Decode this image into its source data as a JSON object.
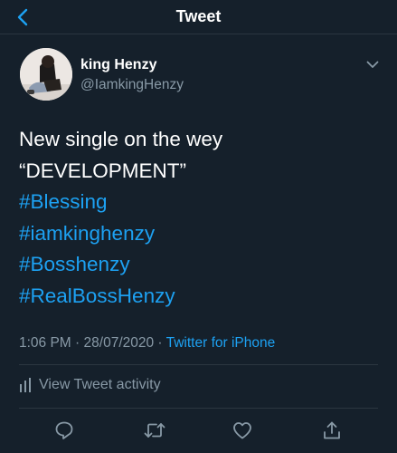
{
  "header": {
    "title": "Tweet",
    "back_icon": "chevron-left-icon"
  },
  "colors": {
    "background": "#15202b",
    "accent": "#1da1f2",
    "secondary_text": "#8899a6",
    "divider": "#2b3640"
  },
  "author": {
    "name": "king Henzy",
    "handle": "@IamkingHenzy",
    "more_icon": "chevron-down-icon"
  },
  "tweet": {
    "lines": [
      {
        "text": "New single on the wey",
        "hashtag": false
      },
      {
        "text": "“DEVELOPMENT”",
        "hashtag": false
      },
      {
        "text": "#Blessing",
        "hashtag": true
      },
      {
        "text": "#iamkinghenzy",
        "hashtag": true
      },
      {
        "text": "#Bosshenzy",
        "hashtag": true
      },
      {
        "text": "#RealBossHenzy",
        "hashtag": true
      }
    ]
  },
  "meta": {
    "time": "1:06 PM",
    "separator": "·",
    "date": "28/07/2020",
    "source": "Twitter for iPhone"
  },
  "activity": {
    "label": "View Tweet activity",
    "icon": "bar-chart-icon"
  },
  "actions": {
    "reply_icon": "reply-icon",
    "retweet_icon": "retweet-icon",
    "like_icon": "heart-icon",
    "share_icon": "share-icon"
  }
}
